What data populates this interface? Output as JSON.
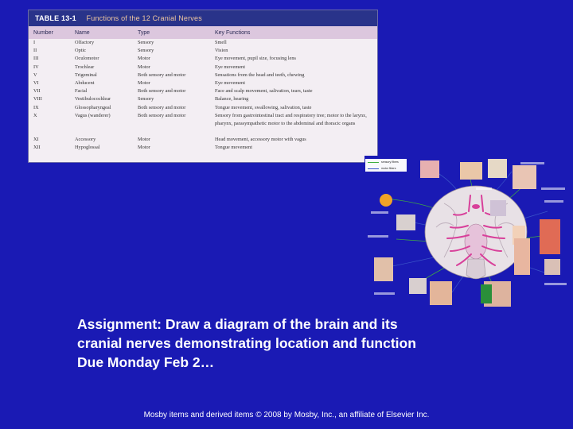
{
  "table": {
    "number": "TABLE 13-1",
    "caption": "Functions of the 12 Cranial Nerves",
    "headers": [
      "Number",
      "Name",
      "Type",
      "Key Functions"
    ],
    "rows": [
      [
        "I",
        "Olfactory",
        "Sensory",
        "Smell"
      ],
      [
        "II",
        "Optic",
        "Sensory",
        "Vision"
      ],
      [
        "III",
        "Oculomotor",
        "Motor",
        "Eye movement, pupil size, focusing lens"
      ],
      [
        "IV",
        "Trochlear",
        "Motor",
        "Eye movement"
      ],
      [
        "V",
        "Trigeminal",
        "Both sensory and motor",
        "Sensations from the head and teeth, chewing"
      ],
      [
        "VI",
        "Abducent",
        "Motor",
        "Eye movement"
      ],
      [
        "VII",
        "Facial",
        "Both sensory and motor",
        "Face and scalp movement, salivation, tears, taste"
      ],
      [
        "VIII",
        "Vestibulocochlear",
        "Sensory",
        "Balance, hearing"
      ],
      [
        "IX",
        "Glossopharyngeal",
        "Both sensory and motor",
        "Tongue movement, swallowing, salivation, taste"
      ],
      [
        "X",
        "Vagus (wanderer)",
        "Both sensory and motor",
        "Sensory from gastrointestinal tract and respiratory tree; motor to the larynx, pharynx, parasympathetic motor to the abdominal and thoracic organs"
      ],
      [
        "XI",
        "Accessory",
        "Motor",
        "Head movement, accessory motor with vagus"
      ],
      [
        "XII",
        "Hypoglossal",
        "Motor",
        "Tongue movement"
      ]
    ]
  },
  "diagram": {
    "legend": [
      "sensory fibers",
      "motor fibers"
    ],
    "colors": {
      "sensory": "#3fae3f",
      "motor": "#3a55c8",
      "brain": "#e9e0e6",
      "nerves": "#d8409a"
    }
  },
  "assignment": {
    "line1": "Assignment:  Draw a diagram of the brain and its",
    "line2": "cranial nerves demonstrating location and function",
    "line3": "Due Monday Feb 2…"
  },
  "footer": "Mosby items and derived items © 2008 by Mosby, Inc., an affiliate of Elsevier Inc."
}
